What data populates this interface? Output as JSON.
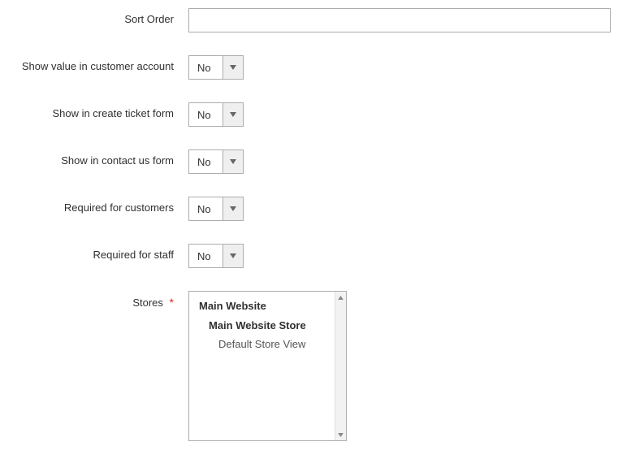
{
  "fields": {
    "sort_order": {
      "label": "Sort Order",
      "value": ""
    },
    "show_customer_account": {
      "label": "Show value in customer account",
      "value": "No"
    },
    "show_create_ticket": {
      "label": "Show in create ticket form",
      "value": "No"
    },
    "show_contact_us": {
      "label": "Show in contact us form",
      "value": "No"
    },
    "required_customers": {
      "label": "Required for customers",
      "value": "No"
    },
    "required_staff": {
      "label": "Required for staff",
      "value": "No"
    },
    "stores": {
      "label": "Stores",
      "required_marker": "*",
      "options": [
        {
          "label": "Main Website",
          "level": 0
        },
        {
          "label": "Main Website Store",
          "level": 1
        },
        {
          "label": "Default Store View",
          "level": 2
        }
      ]
    }
  }
}
